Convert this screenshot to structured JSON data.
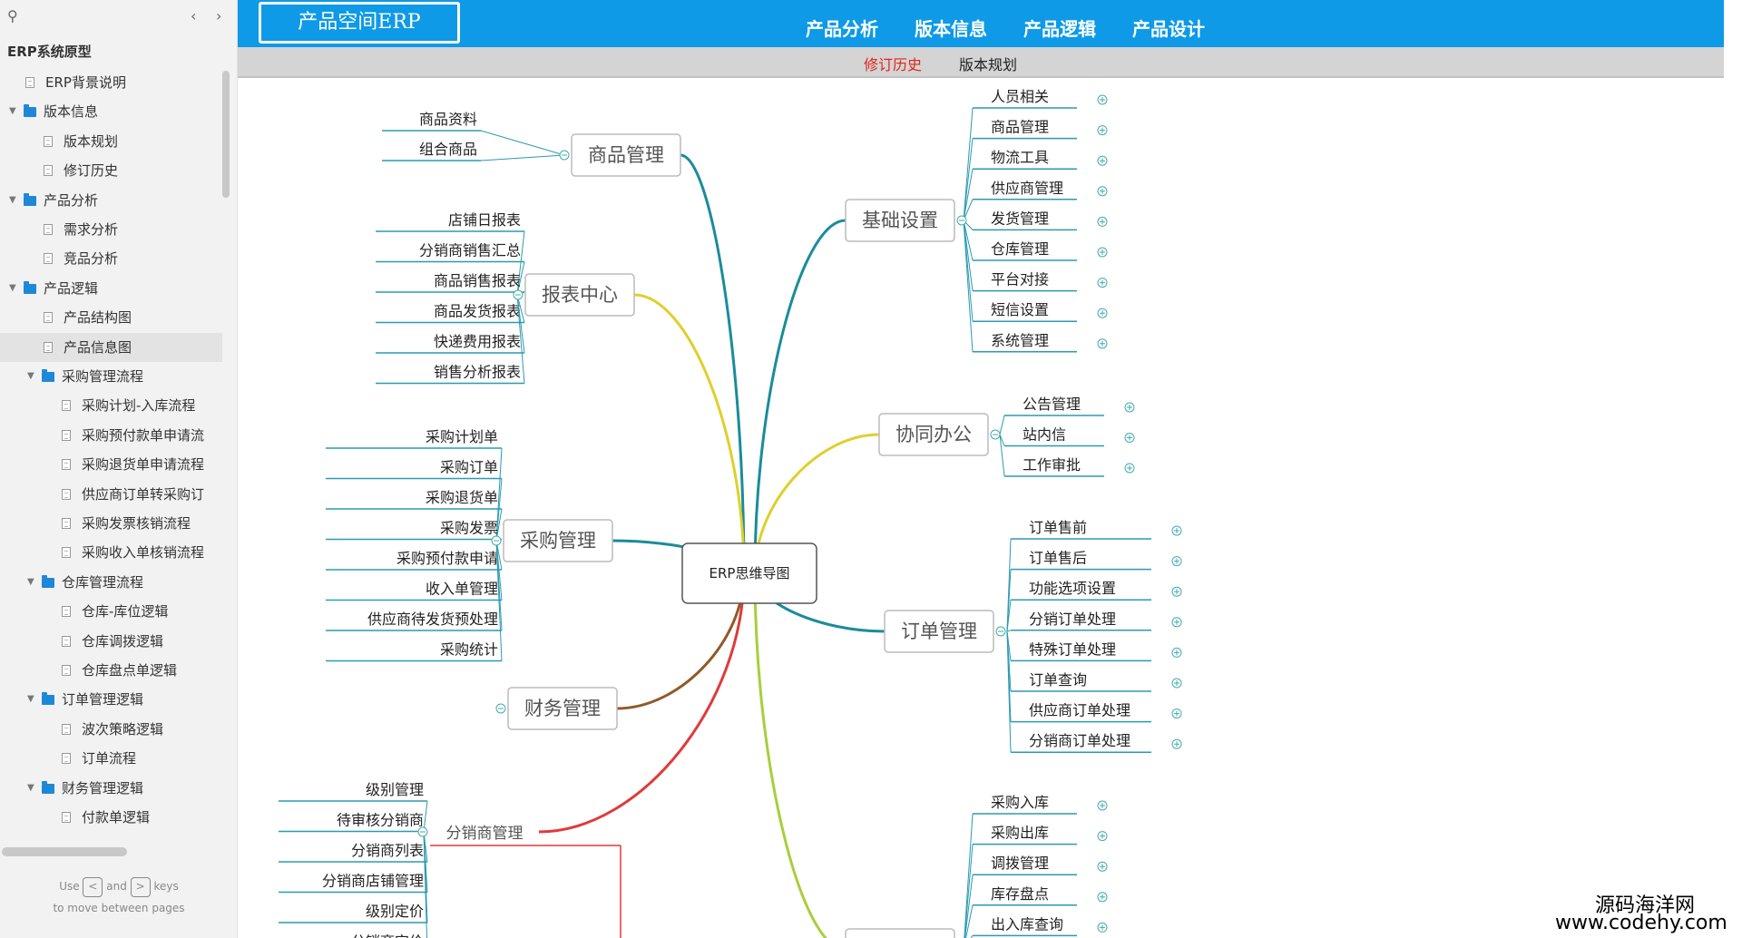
{
  "sidebar": {
    "project_title": "ERP系统原型",
    "items": [
      {
        "label": "ERP背景说明",
        "type": "page",
        "level": 1
      },
      {
        "label": "版本信息",
        "type": "folder",
        "level": 0
      },
      {
        "label": "版本规划",
        "type": "page",
        "level": 2
      },
      {
        "label": "修订历史",
        "type": "page",
        "level": 2
      },
      {
        "label": "产品分析",
        "type": "folder",
        "level": 0
      },
      {
        "label": "需求分析",
        "type": "page",
        "level": 2
      },
      {
        "label": "竞品分析",
        "type": "page",
        "level": 2
      },
      {
        "label": "产品逻辑",
        "type": "folder",
        "level": 0
      },
      {
        "label": "产品结构图",
        "type": "page",
        "level": 2
      },
      {
        "label": "产品信息图",
        "type": "page",
        "level": 2,
        "selected": true
      },
      {
        "label": "采购管理流程",
        "type": "folder",
        "level": 1
      },
      {
        "label": "采购计划-入库流程",
        "type": "page",
        "level": 3
      },
      {
        "label": "采购预付款单申请流",
        "type": "page",
        "level": 3
      },
      {
        "label": "采购退货单申请流程",
        "type": "page",
        "level": 3
      },
      {
        "label": "供应商订单转采购订",
        "type": "page",
        "level": 3
      },
      {
        "label": "采购发票核销流程",
        "type": "page",
        "level": 3
      },
      {
        "label": "采购收入单核销流程",
        "type": "page",
        "level": 3
      },
      {
        "label": "仓库管理流程",
        "type": "folder",
        "level": 1
      },
      {
        "label": "仓库-库位逻辑",
        "type": "page",
        "level": 3
      },
      {
        "label": "仓库调拨逻辑",
        "type": "page",
        "level": 3
      },
      {
        "label": "仓库盘点单逻辑",
        "type": "page",
        "level": 3
      },
      {
        "label": "订单管理逻辑",
        "type": "folder",
        "level": 1
      },
      {
        "label": "波次策略逻辑",
        "type": "page",
        "level": 3
      },
      {
        "label": "订单流程",
        "type": "page",
        "level": 3
      },
      {
        "label": "财务管理逻辑",
        "type": "folder",
        "level": 1
      },
      {
        "label": "付款单逻辑",
        "type": "page",
        "level": 3
      }
    ],
    "hint": {
      "use": "Use",
      "and": "and",
      "keys": "keys",
      "line2": "to move between pages",
      "left_key": "<",
      "right_key": ">"
    }
  },
  "header": {
    "logo": "产品空间ERP",
    "nav": [
      "产品分析",
      "版本信息",
      "产品逻辑",
      "产品设计"
    ]
  },
  "subnav": {
    "items": [
      "修订历史",
      "版本规划"
    ],
    "active": "修订历史"
  },
  "mindmap": {
    "center": "ERP思维导图",
    "branches": [
      {
        "key": "spgl",
        "label": "商品管理",
        "color": "#1a8c9a",
        "leaves": [
          "商品资料",
          "组合商品"
        ]
      },
      {
        "key": "bbzx",
        "label": "报表中心",
        "color": "#e0cf2c",
        "leaves": [
          "店铺日报表",
          "分销商销售汇总",
          "商品销售报表",
          "商品发货报表",
          "快递费用报表",
          "销售分析报表"
        ]
      },
      {
        "key": "cggl",
        "label": "采购管理",
        "color": "#1a8c9a",
        "leaves": [
          "采购计划单",
          "采购订单",
          "采购退货单",
          "采购发票",
          "采购预付款申请",
          "收入单管理",
          "供应商待发货预处理",
          "采购统计"
        ]
      },
      {
        "key": "cwgl",
        "label": "财务管理",
        "color": "#8f5a2a",
        "leaves": []
      },
      {
        "key": "fxsgl",
        "label": "分销商管理",
        "color": "#e03a3a",
        "leaves": [
          "级别管理",
          "待审核分销商",
          "分销商列表",
          "分销商店铺管理",
          "级别定价",
          "分销商定价"
        ]
      },
      {
        "key": "jcsz",
        "label": "基础设置",
        "color": "#1a8c9a",
        "leaves": [
          "人员相关",
          "商品管理",
          "物流工具",
          "供应商管理",
          "发货管理",
          "仓库管理",
          "平台对接",
          "短信设置",
          "系统管理"
        ]
      },
      {
        "key": "xtbg",
        "label": "协同办公",
        "color": "#e0cf2c",
        "leaves": [
          "公告管理",
          "站内信",
          "工作审批"
        ]
      },
      {
        "key": "ddgl",
        "label": "订单管理",
        "color": "#1a8c9a",
        "leaves": [
          "订单售前",
          "订单售后",
          "功能选项设置",
          "分销订单处理",
          "特殊订单处理",
          "订单查询",
          "供应商订单处理",
          "分销商订单处理"
        ]
      },
      {
        "key": "ckgl",
        "label": "",
        "color": "#a6cf3a",
        "leaves": [
          "采购入库",
          "采购出库",
          "调拨管理",
          "库存盘点",
          "出入库查询",
          ""
        ]
      }
    ]
  },
  "colors": {
    "header": "#0e9ae6",
    "accent_red": "#e0241b",
    "sidebar_bg": "#f2f2f2",
    "folder": "#1e88d8"
  },
  "watermark": {
    "line1": "源码海洋网",
    "line2": "www.codehy.com"
  }
}
